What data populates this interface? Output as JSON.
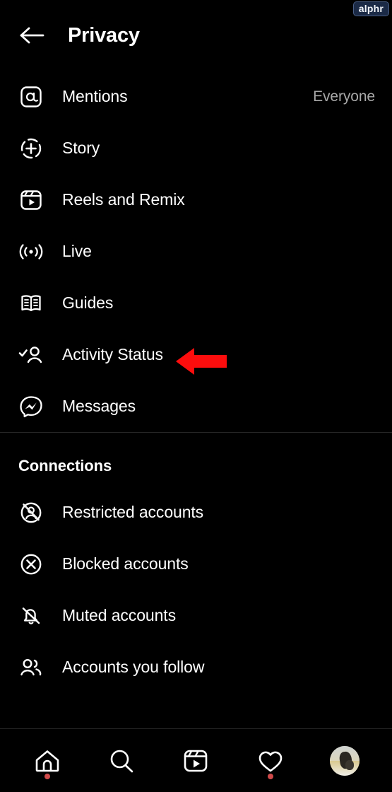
{
  "watermark": {
    "label": "alphr"
  },
  "header": {
    "back_icon": "arrow-left-icon",
    "title": "Privacy"
  },
  "privacy_section": {
    "items": [
      {
        "icon": "mention-at-icon",
        "label": "Mentions",
        "value": "Everyone"
      },
      {
        "icon": "story-plus-icon",
        "label": "Story",
        "value": ""
      },
      {
        "icon": "reels-icon",
        "label": "Reels and Remix",
        "value": ""
      },
      {
        "icon": "live-broadcast-icon",
        "label": "Live",
        "value": ""
      },
      {
        "icon": "guides-book-icon",
        "label": "Guides",
        "value": ""
      },
      {
        "icon": "activity-status-icon",
        "label": "Activity Status",
        "value": ""
      },
      {
        "icon": "messenger-icon",
        "label": "Messages",
        "value": ""
      }
    ]
  },
  "connections_section": {
    "title": "Connections",
    "items": [
      {
        "icon": "restricted-account-icon",
        "label": "Restricted accounts"
      },
      {
        "icon": "blocked-account-icon",
        "label": "Blocked accounts"
      },
      {
        "icon": "muted-bell-icon",
        "label": "Muted accounts"
      },
      {
        "icon": "accounts-you-follow-icon",
        "label": "Accounts you follow"
      }
    ]
  },
  "callout": {
    "shape": "left-pointing-arrow",
    "color": "#fc0d0d",
    "points_to": "Activity Status"
  },
  "bottom_nav": {
    "items": [
      {
        "icon": "home-icon",
        "badge": true
      },
      {
        "icon": "search-icon",
        "badge": false
      },
      {
        "icon": "reels-icon",
        "badge": false
      },
      {
        "icon": "heart-icon",
        "badge": true
      },
      {
        "icon": "profile-avatar",
        "badge": false
      }
    ],
    "badge_color": "#d04a4a"
  },
  "colors": {
    "background": "#000000",
    "text": "#ffffff",
    "muted_text": "#a8a8a8",
    "divider": "#262626",
    "accent_red": "#fc0d0d"
  }
}
